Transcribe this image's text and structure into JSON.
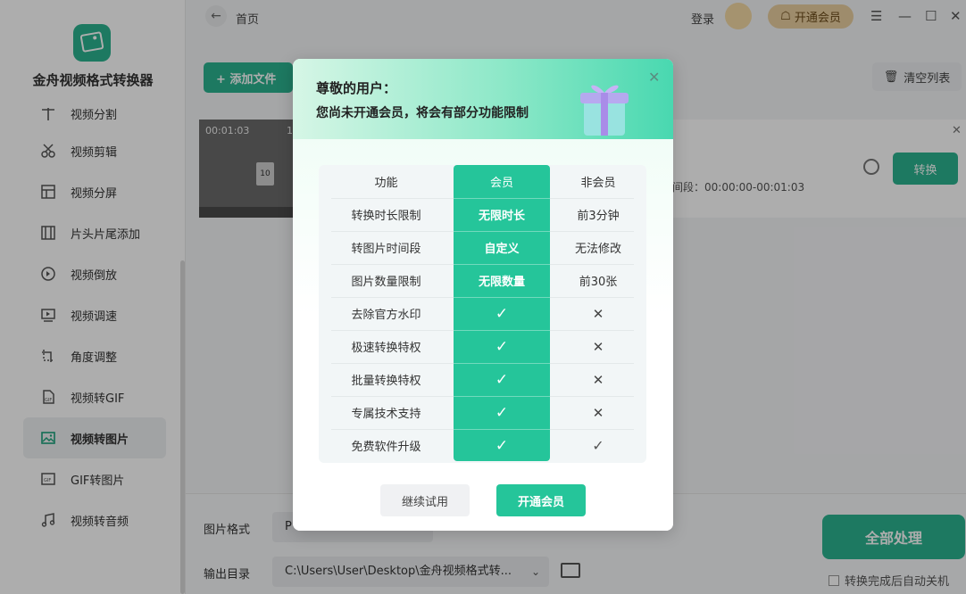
{
  "app": {
    "name": "金舟视频格式转换器"
  },
  "sidebar": {
    "items": [
      {
        "label": "视频分割",
        "icon": "split-icon"
      },
      {
        "label": "视频剪辑",
        "icon": "scissors-icon"
      },
      {
        "label": "视频分屏",
        "icon": "split-screen-icon"
      },
      {
        "label": "片头片尾添加",
        "icon": "film-strip-icon"
      },
      {
        "label": "视频倒放",
        "icon": "rewind-icon"
      },
      {
        "label": "视频调速",
        "icon": "play-speed-icon"
      },
      {
        "label": "角度调整",
        "icon": "crop-rotate-icon"
      },
      {
        "label": "视频转GIF",
        "icon": "gif-file-icon"
      },
      {
        "label": "视频转图片",
        "icon": "image-icon",
        "active": true
      },
      {
        "label": "GIF转图片",
        "icon": "gif-image-icon"
      },
      {
        "label": "视频转音频",
        "icon": "music-icon"
      }
    ]
  },
  "topbar": {
    "breadcrumb": "首页",
    "login": "登录",
    "vip_button": "开通会员"
  },
  "toolbar": {
    "add_file": "+ 添加文件",
    "clear_list": "清空列表"
  },
  "file": {
    "timestamp": "00:01:03",
    "timestamp_right": "1",
    "segment_label": "间段：00:00:00-00:01:03",
    "convert": "转换",
    "thumb_text": "10"
  },
  "bottom": {
    "format_label": "图片格式",
    "format_value": "P",
    "output_label": "输出目录",
    "output_path": "C:\\Users\\User\\Desktop\\金舟视频格式转...",
    "process_all": "全部处理",
    "auto_shutdown": "转换完成后自动关机"
  },
  "modal": {
    "greeting": "尊敬的用户：",
    "notice": "您尚未开通会员，将会有部分功能限制",
    "table": {
      "headers": [
        "功能",
        "会员",
        "非会员"
      ],
      "rows": [
        {
          "feature": "转换时长限制",
          "member": "无限时长",
          "non_member": "前3分钟"
        },
        {
          "feature": "转图片时间段",
          "member": "自定义",
          "non_member": "无法修改"
        },
        {
          "feature": "图片数量限制",
          "member": "无限数量",
          "non_member": "前30张"
        },
        {
          "feature": "去除官方水印",
          "member": "✓",
          "non_member": "✕"
        },
        {
          "feature": "极速转换特权",
          "member": "✓",
          "non_member": "✕"
        },
        {
          "feature": "批量转换特权",
          "member": "✓",
          "non_member": "✕"
        },
        {
          "feature": "专属技术支持",
          "member": "✓",
          "non_member": "✕"
        },
        {
          "feature": "免费软件升级",
          "member": "✓",
          "non_member": "✓"
        }
      ]
    },
    "buttons": {
      "trial": "继续试用",
      "open_vip": "开通会员"
    }
  },
  "colors": {
    "accent": "#25c59a",
    "vip_gold": "#e9cf9f"
  }
}
